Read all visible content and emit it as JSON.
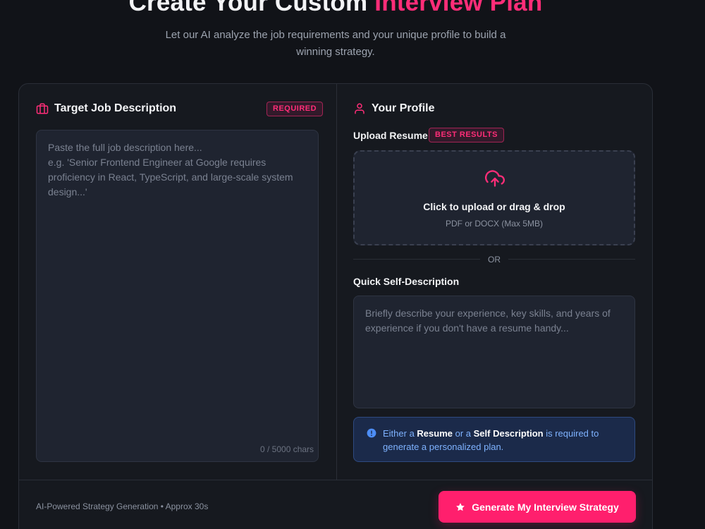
{
  "hero": {
    "title_prefix": "Create Your Custom ",
    "title_accent": "Interview Plan",
    "subtitle": "Let our AI analyze the job requirements and your unique profile to build a winning strategy."
  },
  "job": {
    "heading": "Target Job Description",
    "badge": "REQUIRED",
    "placeholder": "Paste the full job description here...\ne.g. 'Senior Frontend Engineer at Google requires proficiency in React, TypeScript, and large-scale system design...'",
    "char_count": "0 / 5000 chars"
  },
  "profile": {
    "heading": "Your Profile",
    "upload_label": "Upload Resume",
    "upload_badge": "BEST RESULTS",
    "upload_title": "Click to upload or drag & drop",
    "upload_sub": "PDF or DOCX (Max 5MB)",
    "or_text": "OR",
    "self_label": "Quick Self-Description",
    "self_placeholder": "Briefly describe your experience, key skills, and years of experience if you don't have a resume handy...",
    "info": {
      "part1": "Either a ",
      "bold1": "Resume",
      "part2": " or a ",
      "bold2": "Self Description",
      "part3": " is required to generate a personalized plan."
    }
  },
  "footer": {
    "note": "AI-Powered Strategy Generation • Approx 30s",
    "button_label": "Generate My Interview Strategy"
  },
  "colors": {
    "accent": "#ff2d78",
    "info_text": "#7eb2ff",
    "background": "#111318"
  },
  "icons": {
    "job": "briefcase-icon",
    "profile": "user-icon",
    "upload": "cloud-upload-icon",
    "info": "info-icon",
    "button": "star-icon"
  }
}
